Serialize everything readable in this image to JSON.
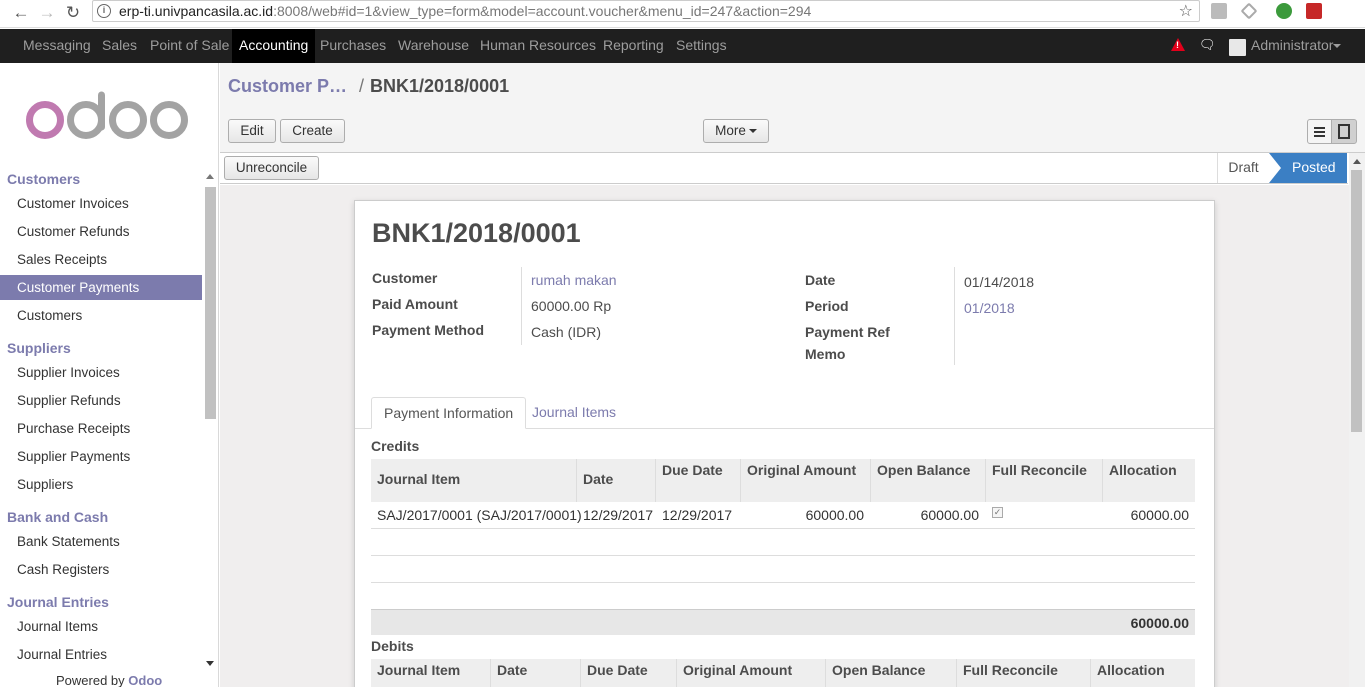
{
  "browser": {
    "url_host": "erp-ti.univpancasila.ac.id",
    "url_rest": ":8008/web#id=1&view_type=form&model=account.voucher&menu_id=247&action=294"
  },
  "topbar": {
    "menus": [
      "Messaging",
      "Sales",
      "Point of Sale",
      "Accounting",
      "Purchases",
      "Warehouse",
      "Human Resources",
      "Reporting",
      "Settings"
    ],
    "active_menu": "Accounting",
    "user": "Administrator"
  },
  "sidebar": {
    "logo": "odoo",
    "sections": [
      {
        "title": "Customers",
        "items": [
          "Customer Invoices",
          "Customer Refunds",
          "Sales Receipts",
          "Customer Payments",
          "Customers"
        ]
      },
      {
        "title": "Suppliers",
        "items": [
          "Supplier Invoices",
          "Supplier Refunds",
          "Purchase Receipts",
          "Supplier Payments",
          "Suppliers"
        ]
      },
      {
        "title": "Bank and Cash",
        "items": [
          "Bank Statements",
          "Cash Registers"
        ]
      },
      {
        "title": "Journal Entries",
        "items": [
          "Journal Items",
          "Journal Entries"
        ]
      }
    ],
    "active_item": "Customer Payments",
    "powered_prefix": "Powered by",
    "powered_brand": "Odoo"
  },
  "control": {
    "breadcrumb_parent": "Customer P…",
    "breadcrumb_sep": "/",
    "breadcrumb_current": "BNK1/2018/0001",
    "edit_label": "Edit",
    "create_label": "Create",
    "more_label": "More"
  },
  "statusbar": {
    "unreconcile_label": "Unreconcile",
    "stages": [
      "Draft",
      "Posted"
    ],
    "current_stage": "Posted"
  },
  "form": {
    "title": "BNK1/2018/0001",
    "left_fields": [
      {
        "label": "Customer",
        "value": "rumah makan"
      },
      {
        "label": "Paid Amount",
        "value": "60000.00 Rp"
      },
      {
        "label": "Payment Method",
        "value": "Cash (IDR)"
      }
    ],
    "right_fields": [
      {
        "label": "Date",
        "value": "01/14/2018"
      },
      {
        "label": "Period",
        "value": "01/2018"
      },
      {
        "label": "Payment Ref",
        "value": ""
      },
      {
        "label": "Memo",
        "value": ""
      }
    ],
    "tabs": [
      "Payment Information",
      "Journal Items"
    ],
    "active_tab": "Payment Information",
    "credits": {
      "title": "Credits",
      "columns": [
        "Journal Item",
        "Date",
        "Due Date",
        "Original Amount",
        "Open Balance",
        "Full Reconcile",
        "Allocation"
      ],
      "rows": [
        {
          "journal_item": "SAJ/2017/0001 (SAJ/2017/0001)",
          "date": "12/29/2017",
          "due_date": "12/29/2017",
          "original_amount": "60000.00",
          "open_balance": "60000.00",
          "full_reconcile": true,
          "allocation": "60000.00"
        }
      ],
      "total": "60000.00"
    },
    "debits": {
      "title": "Debits",
      "columns": [
        "Journal Item",
        "Date",
        "Due Date",
        "Original Amount",
        "Open Balance",
        "Full Reconcile",
        "Allocation"
      ]
    }
  }
}
